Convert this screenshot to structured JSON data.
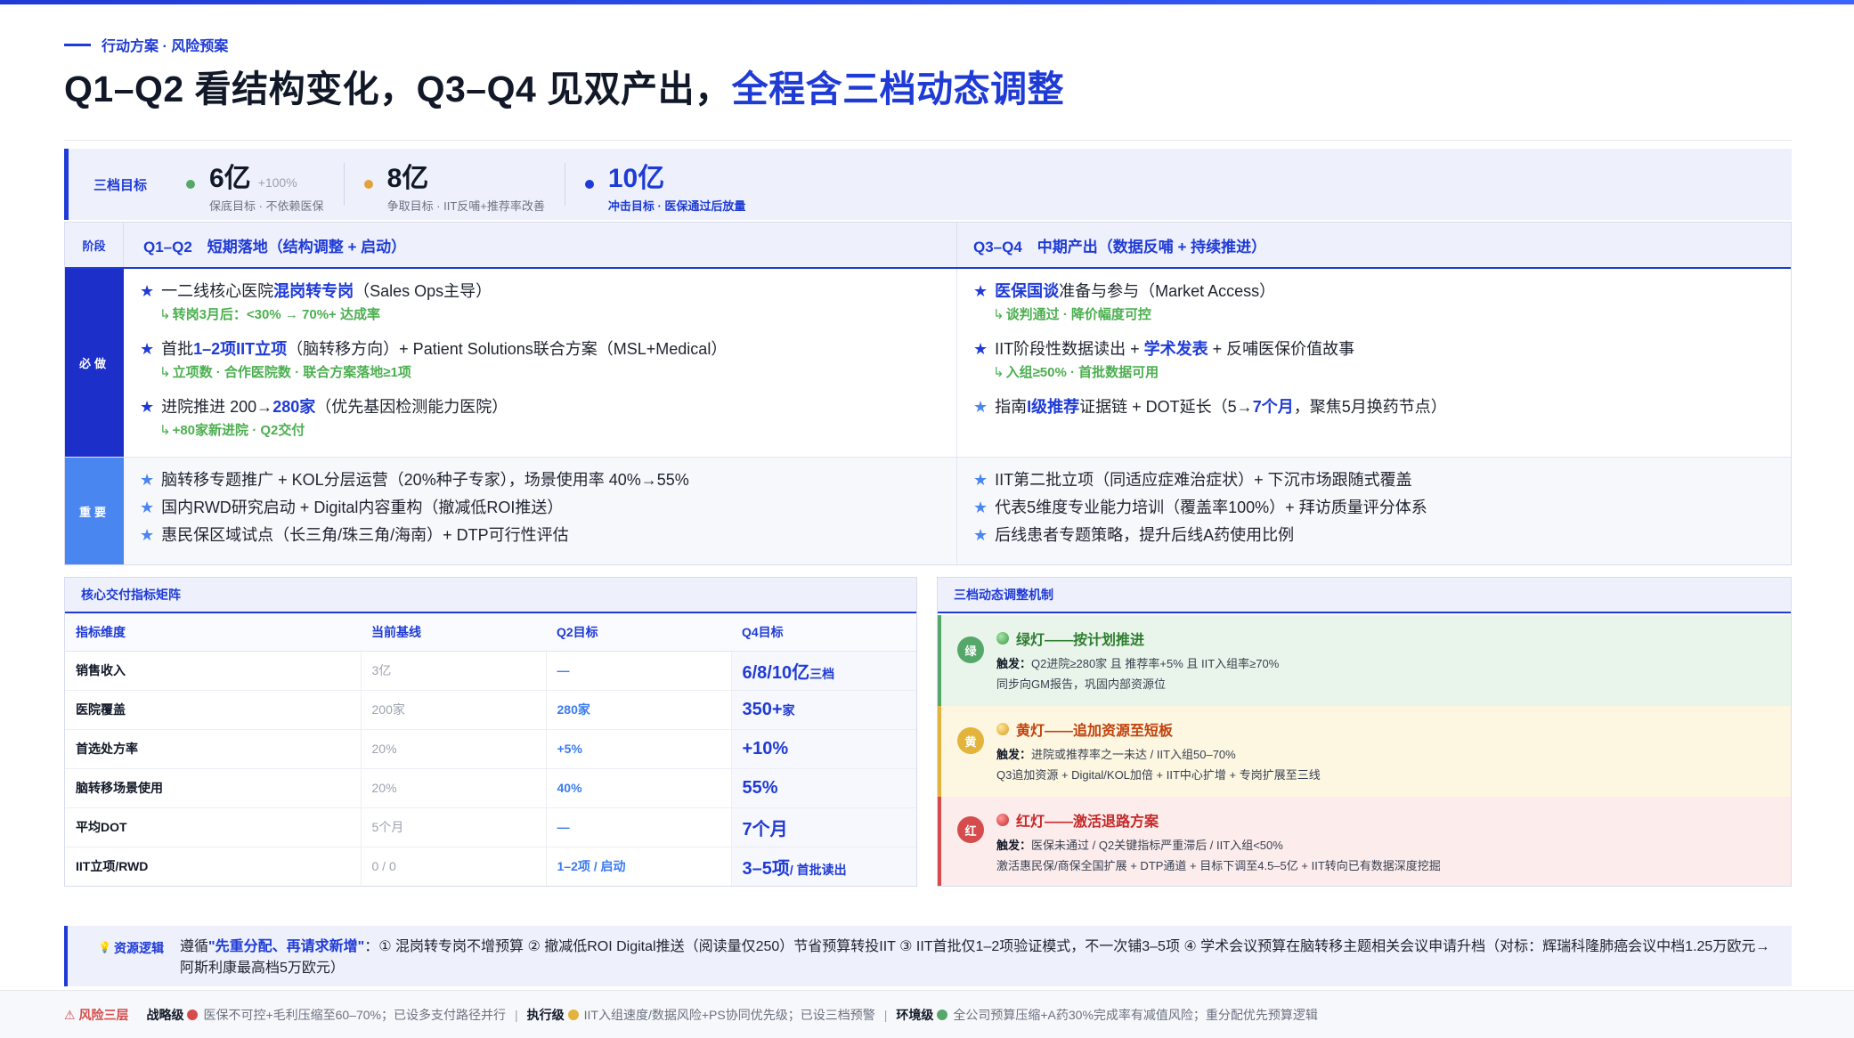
{
  "eyebrow": "行动方案 · 风险预案",
  "title": {
    "main": "Q1–Q2 看结构变化，Q3–Q4 见双产出，",
    "highlight": "全程含三档动态调整"
  },
  "targets": {
    "label": "三档目标",
    "items": [
      {
        "value": "6亿",
        "tag": "+100%",
        "sub": "保底目标 · 不依赖医保",
        "color": "#56a86a"
      },
      {
        "value": "8亿",
        "tag": "",
        "sub": "争取目标 · IIT反哺+推荐率改善",
        "color": "#e2a23b"
      },
      {
        "value": "10亿",
        "tag": "",
        "sub": "冲击目标 · 医保通过后放量",
        "color": "#1f3bd6"
      }
    ]
  },
  "phase": {
    "head_label": "阶段",
    "q12_header": "Q1–Q2　短期落地（结构调整 + 启动）",
    "q34_header": "Q3–Q4　中期产出（数据反哺 + 持续推进）",
    "must_label": "必做",
    "imp_label": "重要",
    "must_left": [
      {
        "pre": "一二线核心医院",
        "bold": "混岗转专岗",
        "post": "（Sales Ops主导）",
        "note": "转岗3月后：<30% → 70%+ 达成率"
      },
      {
        "pre": "首批",
        "bold": "1–2项IIT立项",
        "post": "（脑转移方向）+ Patient Solutions联合方案（MSL+Medical）",
        "note": "立项数 · 合作医院数 · 联合方案落地≥1项"
      },
      {
        "pre": "进院推进 200→",
        "bold": "280家",
        "post": "（优先基因检测能力医院）",
        "note": "+80家新进院 · Q2交付"
      }
    ],
    "must_right": [
      {
        "pre": "",
        "bold": "医保国谈",
        "post": "准备与参与（Market Access）",
        "note": "谈判通过 · 降价幅度可控"
      },
      {
        "pre": "IIT阶段性数据读出 + ",
        "bold": "学术发表",
        "post": " + 反哺医保价值故事",
        "note": "入组≥50% · 首批数据可用"
      },
      {
        "pre": "指南",
        "bold": "I级推荐",
        "post": "证据链 + DOT延长（5→",
        "bold2": "7个月",
        "post2": "，聚焦5月换药节点）"
      }
    ],
    "imp_left": [
      "脑转移专题推广 + KOL分层运营（20%种子专家），场景使用率 40%→55%",
      "国内RWD研究启动 + Digital内容重构（撤减低ROI推送）",
      "惠民保区域试点（长三角/珠三角/海南）+ DTP可行性评估"
    ],
    "imp_right": [
      "IIT第二批立项（同适应症难治症状）+ 下沉市场跟随式覆盖",
      "代表5维度专业能力培训（覆盖率100%）+ 拜访质量评分体系",
      "后线患者专题策略，提升后线A药使用比例"
    ]
  },
  "kpi": {
    "title": "核心交付指标矩阵",
    "headers": [
      "指标维度",
      "当前基线",
      "Q2目标",
      "Q4目标"
    ],
    "rows": [
      {
        "metric": "销售收入",
        "base": "3亿",
        "q2": "—",
        "q4": "6/8/10亿",
        "q4_suffix": "三档"
      },
      {
        "metric": "医院覆盖",
        "base": "200家",
        "q2": "280家",
        "q4": "350+",
        "q4_suffix": "家"
      },
      {
        "metric": "首选处方率",
        "base": "20%",
        "q2": "+5%",
        "q4": "+10%",
        "q4_suffix": ""
      },
      {
        "metric": "脑转移场景使用",
        "base": "20%",
        "q2": "40%",
        "q4": "55%",
        "q4_suffix": ""
      },
      {
        "metric": "平均DOT",
        "base": "5个月",
        "q2": "—",
        "q4": "7个月",
        "q4_suffix": ""
      },
      {
        "metric": "IIT立项/RWD",
        "base": "0 / 0",
        "q2": "1–2项 / 启动",
        "q4": "3–5项",
        "q4_suffix": "/ 首批读出"
      }
    ]
  },
  "mechanism": {
    "title": "三档动态调整机制",
    "lamps": [
      {
        "badge": "绿",
        "head": "绿灯——按计划推进",
        "trigger_label": "触发：",
        "trigger": "Q2进院≥280家 且 推荐率+5% 且 IIT入组率≥70%",
        "action": "同步向GM报告，巩固内部资源位"
      },
      {
        "badge": "黄",
        "head": "黄灯——追加资源至短板",
        "trigger_label": "触发：",
        "trigger": "进院或推荐率之一未达 / IIT入组50–70%",
        "action": "Q3追加资源 + Digital/KOL加倍 + IIT中心扩增 + 专岗扩展至三线"
      },
      {
        "badge": "红",
        "head": "红灯——激活退路方案",
        "trigger_label": "触发：",
        "trigger": "医保未通过 / Q2关键指标严重滞后 / IIT入组<50%",
        "action": "激活惠民保/商保全国扩展 + DTP通道 + 目标下调至4.5–5亿 + IIT转向已有数据深度挖掘"
      }
    ]
  },
  "resource": {
    "label": "资源逻辑",
    "pre": "遵循",
    "bold": "\"先重分配、再请求新增\"",
    "text": "：① 混岗转专岗不增预算 ② 撤减低ROI Digital推送（阅读量仅250）节省预算转投IIT ③ IIT首批仅1–2项验证模式，不一次铺3–5项 ④ 学术会议预算在脑转移主题相关会议申请升档（对标：辉瑞科隆肺癌会议中档1.25万欧元→阿斯利康最高档5万欧元）"
  },
  "risk": {
    "label": "风险三层",
    "items": [
      {
        "level": "战略级",
        "color": "#d64b4b",
        "text": "医保不可控+毛利压缩至60–70%；已设多支付路径并行"
      },
      {
        "level": "执行级",
        "color": "#e2b43b",
        "text": "IIT入组速度/数据风险+PS协同优先级；已设三档预警"
      },
      {
        "level": "环境级",
        "color": "#56a86a",
        "text": "全公司预算压缩+A药30%完成率有减值风险；重分配优先预算逻辑"
      }
    ]
  }
}
